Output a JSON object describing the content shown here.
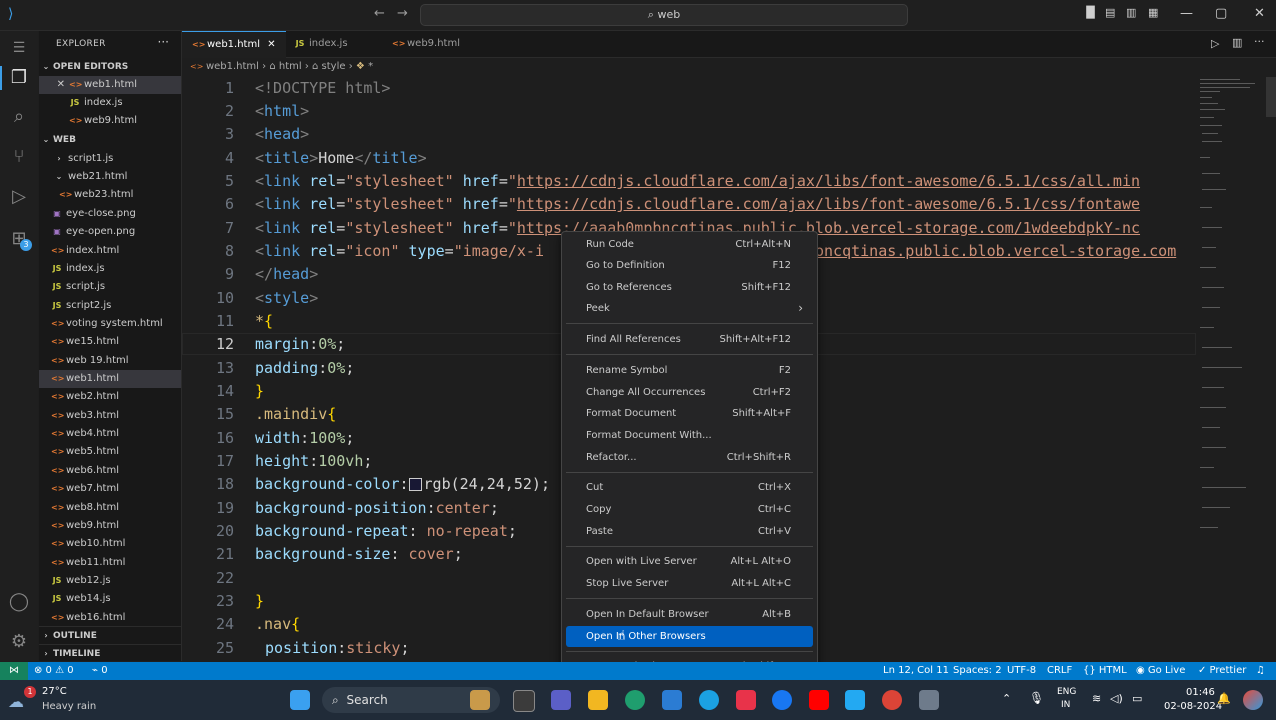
{
  "titlebar": {
    "search": "web",
    "search_icon": "search-icon"
  },
  "sidebar": {
    "title": "EXPLORER",
    "more": "···",
    "open_editors_label": "OPEN EDITORS",
    "open_editors": [
      "web1.html",
      "index.js",
      "web9.html"
    ],
    "folder_label": "WEB",
    "files": [
      "script1.js",
      "web21.html",
      "web23.html",
      "eye-close.png",
      "eye-open.png",
      "index.html",
      "index.js",
      "script.js",
      "script2.js",
      "voting system.html",
      "we15.html",
      "web 19.html",
      "web1.html",
      "web2.html",
      "web3.html",
      "web4.html",
      "web5.html",
      "web6.html",
      "web7.html",
      "web8.html",
      "web9.html",
      "web10.html",
      "web11.html",
      "web12.js",
      "web14.js",
      "web16.html"
    ],
    "outline_label": "OUTLINE",
    "timeline_label": "TIMELINE"
  },
  "tabs": [
    {
      "label": "web1.html",
      "icon": "html-file-icon",
      "close": "✕"
    },
    {
      "label": "index.js",
      "icon": "js-file-icon"
    },
    {
      "label": "web9.html",
      "icon": "html-file-icon"
    }
  ],
  "breadcrumb": {
    "file": "web1.html",
    "html": "html",
    "style": "style",
    "star": "*"
  },
  "code_lines": [
    "1",
    "2",
    "3",
    "4",
    "5",
    "6",
    "7",
    "8",
    "9",
    "10",
    "11",
    "12",
    "13",
    "14",
    "15",
    "16",
    "17",
    "18",
    "19",
    "20",
    "21",
    "22",
    "23",
    "24",
    "25"
  ],
  "code": {
    "l1": "<!DOCTYPE html>",
    "title_text": "Home",
    "url5": "https://cdnjs.cloudflare.com/ajax/libs/font-awesome/6.5.1/css/all.min",
    "url6": "https://cdnjs.cloudflare.com/ajax/libs/font-awesome/6.5.1/css/fontawe",
    "url7": "https://aaab0mpbncqtinas.public.blob.vercel-storage.com/1wdeebdpkY-nc",
    "url8": "oncqtinas.public.blob.vercel-storage.com",
    "rgb": "rgb(24,24,52)"
  },
  "context_menu": [
    {
      "label": "Run Code",
      "shortcut": "Ctrl+Alt+N"
    },
    {
      "label": "Go to Definition",
      "shortcut": "F12"
    },
    {
      "label": "Go to References",
      "shortcut": "Shift+F12"
    },
    {
      "label": "Peek",
      "shortcut": "›"
    },
    {
      "label": "Find All References",
      "shortcut": "Shift+Alt+F12"
    },
    {
      "label": "Rename Symbol",
      "shortcut": "F2"
    },
    {
      "label": "Change All Occurrences",
      "shortcut": "Ctrl+F2"
    },
    {
      "label": "Format Document",
      "shortcut": "Shift+Alt+F"
    },
    {
      "label": "Format Document With...",
      "shortcut": ""
    },
    {
      "label": "Refactor...",
      "shortcut": "Ctrl+Shift+R"
    },
    {
      "label": "Cut",
      "shortcut": "Ctrl+X"
    },
    {
      "label": "Copy",
      "shortcut": "Ctrl+C"
    },
    {
      "label": "Paste",
      "shortcut": "Ctrl+V"
    },
    {
      "label": "Open with Live Server",
      "shortcut": "Alt+L Alt+O"
    },
    {
      "label": "Stop Live Server",
      "shortcut": "Alt+L Alt+C"
    },
    {
      "label": "Open In Default Browser",
      "shortcut": "Alt+B"
    },
    {
      "label": "Open In Other Browsers",
      "shortcut": ""
    },
    {
      "label": "Command Palette...",
      "shortcut": "Ctrl+Shift+P"
    }
  ],
  "status": {
    "errors": "⊗ 0 ⚠ 0",
    "ports": "⌁ 0",
    "position": "Ln 12, Col 11",
    "spaces": "Spaces: 2",
    "encoding": "UTF-8",
    "eol": "CRLF",
    "language": "{} HTML",
    "golive": "Go Live",
    "prettier": "✓ Prettier"
  },
  "taskbar": {
    "weather_temp": "27°C",
    "weather_desc": "Heavy rain",
    "weather_badge": "1",
    "search": "Search",
    "lang1": "ENG",
    "lang2": "IN",
    "time": "01:46",
    "date": "02-08-2024"
  }
}
